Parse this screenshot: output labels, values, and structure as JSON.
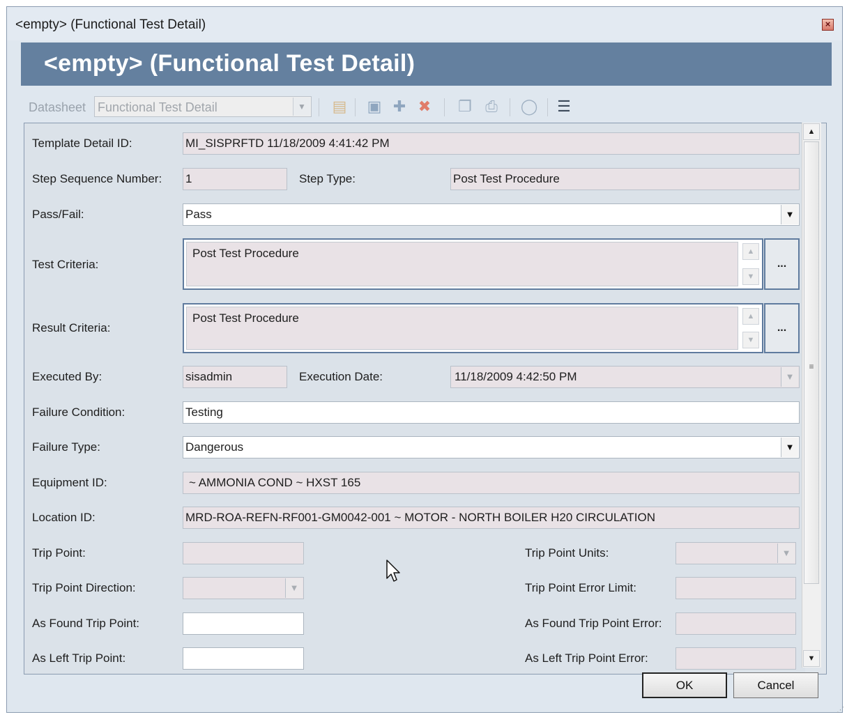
{
  "window": {
    "title": "<empty> (Functional Test Detail)",
    "close_icon": "close-icon"
  },
  "header": {
    "title": "<empty> (Functional Test Detail)"
  },
  "toolbar": {
    "datasheet_label": "Datasheet",
    "datasheet_value": "Functional Test Detail",
    "icons": [
      "new-record-icon",
      "save-icon",
      "save-new-icon",
      "delete-icon",
      "copy-icon",
      "print-icon",
      "refresh-icon",
      "report-icon"
    ]
  },
  "form": {
    "template_detail_id": {
      "label": "Template Detail ID:",
      "value": "MI_SISPRFTD 11/18/2009 4:41:42 PM"
    },
    "step_sequence_number": {
      "label": "Step Sequence Number:",
      "value": "1"
    },
    "step_type": {
      "label": "Step Type:",
      "value": "Post Test Procedure"
    },
    "pass_fail": {
      "label": "Pass/Fail:",
      "value": "Pass"
    },
    "test_criteria": {
      "label": "Test Criteria:",
      "value": "Post Test Procedure",
      "button": "..."
    },
    "result_criteria": {
      "label": "Result Criteria:",
      "value": "Post Test Procedure",
      "button": "..."
    },
    "executed_by": {
      "label": "Executed By:",
      "value": "sisadmin"
    },
    "execution_date": {
      "label": "Execution Date:",
      "value": "11/18/2009 4:42:50 PM"
    },
    "failure_condition": {
      "label": "Failure Condition:",
      "value": "Testing"
    },
    "failure_type": {
      "label": "Failure Type:",
      "value": "Dangerous"
    },
    "equipment_id": {
      "label": "Equipment ID:",
      "value": "~ AMMONIA COND ~ HXST 165"
    },
    "location_id": {
      "label": "Location ID:",
      "value": "MRD-ROA-REFN-RF001-GM0042-001 ~ MOTOR - NORTH BOILER H20 CIRCULATION"
    },
    "trip_point": {
      "label": "Trip Point:",
      "value": ""
    },
    "trip_point_units": {
      "label": "Trip Point Units:",
      "value": ""
    },
    "trip_point_direction": {
      "label": "Trip Point Direction:",
      "value": ""
    },
    "trip_point_error_limit": {
      "label": "Trip Point Error Limit:",
      "value": ""
    },
    "as_found_trip_point": {
      "label": "As Found Trip Point:",
      "value": ""
    },
    "as_found_trip_point_error": {
      "label": "As Found Trip Point Error:",
      "value": ""
    },
    "as_left_trip_point": {
      "label": "As Left Trip Point:",
      "value": ""
    },
    "as_left_trip_point_error": {
      "label": "As Left Trip Point Error:",
      "value": ""
    }
  },
  "buttons": {
    "ok": "OK",
    "cancel": "Cancel"
  }
}
